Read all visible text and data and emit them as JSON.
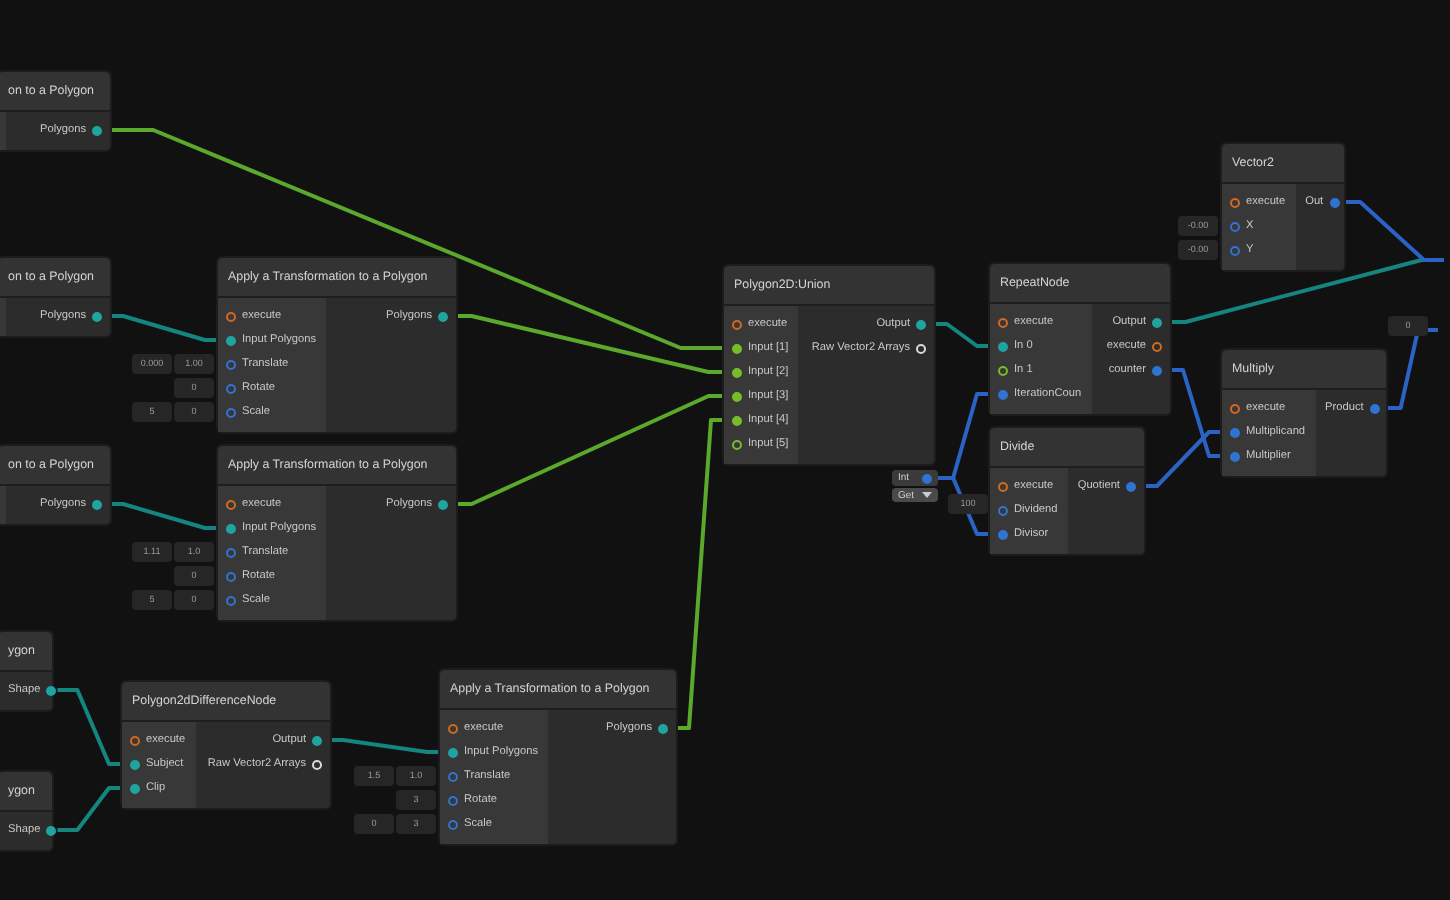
{
  "nodes": [
    {
      "title": "on to a Polygon",
      "outputs": [
        {
          "label": "Polygons",
          "kind": "polygon",
          "connected": true
        }
      ]
    },
    {
      "title": "on to a Polygon",
      "outputs": [
        {
          "label": "Polygons",
          "kind": "polygon",
          "connected": true
        }
      ]
    },
    {
      "title": "on to a Polygon",
      "outputs": [
        {
          "label": "Polygons",
          "kind": "polygon",
          "connected": true
        }
      ]
    },
    {
      "title": "ygon",
      "outputs": [
        {
          "label": "Shape",
          "kind": "polygon",
          "connected": true
        }
      ]
    },
    {
      "title": "ygon",
      "outputs": [
        {
          "label": "Shape",
          "kind": "polygon",
          "connected": true
        }
      ]
    },
    {
      "title": "Apply a Transformation to a Polygon",
      "inputs": [
        {
          "label": "execute",
          "kind": "exec",
          "connected": false
        },
        {
          "label": "Input Polygons",
          "kind": "polygon",
          "connected": true
        },
        {
          "label": "Translate",
          "kind": "number",
          "connected": false,
          "fields": [
            "0.000",
            "1.00"
          ]
        },
        {
          "label": "Rotate",
          "kind": "number",
          "connected": false,
          "fields": [
            "0"
          ]
        },
        {
          "label": "Scale",
          "kind": "number",
          "connected": false,
          "fields": [
            "5",
            "0"
          ]
        }
      ],
      "outputs": [
        {
          "label": "Polygons",
          "kind": "polygon",
          "connected": true
        }
      ]
    },
    {
      "title": "Apply a Transformation to a Polygon",
      "inputs": [
        {
          "label": "execute",
          "kind": "exec",
          "connected": false
        },
        {
          "label": "Input Polygons",
          "kind": "polygon",
          "connected": true
        },
        {
          "label": "Translate",
          "kind": "number",
          "connected": false,
          "fields": [
            "1.11",
            "1.0"
          ]
        },
        {
          "label": "Rotate",
          "kind": "number",
          "connected": false,
          "fields": [
            "0"
          ]
        },
        {
          "label": "Scale",
          "kind": "number",
          "connected": false,
          "fields": [
            "5",
            "0"
          ]
        }
      ],
      "outputs": [
        {
          "label": "Polygons",
          "kind": "polygon",
          "connected": true
        }
      ]
    },
    {
      "title": "Polygon2dDifferenceNode",
      "inputs": [
        {
          "label": "execute",
          "kind": "exec",
          "connected": false
        },
        {
          "label": "Subject",
          "kind": "polygon",
          "connected": true
        },
        {
          "label": "Clip",
          "kind": "polygon",
          "connected": true
        }
      ],
      "outputs": [
        {
          "label": "Output",
          "kind": "polygon",
          "connected": true
        },
        {
          "label": "Raw Vector2 Arrays",
          "kind": "array",
          "connected": false
        }
      ]
    },
    {
      "title": "Apply a Transformation to a Polygon",
      "inputs": [
        {
          "label": "execute",
          "kind": "exec",
          "connected": false
        },
        {
          "label": "Input Polygons",
          "kind": "polygon",
          "connected": true
        },
        {
          "label": "Translate",
          "kind": "number",
          "connected": false,
          "fields": [
            "1.5",
            "1.0"
          ]
        },
        {
          "label": "Rotate",
          "kind": "number",
          "connected": false,
          "fields": [
            "3"
          ]
        },
        {
          "label": "Scale",
          "kind": "number",
          "connected": false,
          "fields": [
            "0",
            "3"
          ]
        }
      ],
      "outputs": [
        {
          "label": "Polygons",
          "kind": "polygon",
          "connected": true
        }
      ]
    },
    {
      "title": "Polygon2D:Union",
      "inputs": [
        {
          "label": "execute",
          "kind": "exec",
          "connected": false
        },
        {
          "label": "Input [1]",
          "kind": "list",
          "connected": true
        },
        {
          "label": "Input [2]",
          "kind": "list",
          "connected": true
        },
        {
          "label": "Input [3]",
          "kind": "list",
          "connected": true
        },
        {
          "label": "Input [4]",
          "kind": "list",
          "connected": true
        },
        {
          "label": "Input [5]",
          "kind": "list",
          "connected": false
        }
      ],
      "outputs": [
        {
          "label": "Output",
          "kind": "polygon",
          "connected": true
        },
        {
          "label": "Raw Vector2 Arrays",
          "kind": "array",
          "connected": false
        }
      ]
    },
    {
      "title": "RepeatNode",
      "inputs": [
        {
          "label": "execute",
          "kind": "exec",
          "connected": false
        },
        {
          "label": "In 0",
          "kind": "polygon",
          "connected": true
        },
        {
          "label": "In 1",
          "kind": "list",
          "connected": false
        },
        {
          "label": "IterationCoun",
          "kind": "number",
          "connected": true
        }
      ],
      "outputs": [
        {
          "label": "Output",
          "kind": "polygon",
          "connected": true
        },
        {
          "label": "execute",
          "kind": "exec",
          "connected": false
        },
        {
          "label": "counter",
          "kind": "number",
          "connected": true
        }
      ]
    },
    {
      "title": "Divide",
      "inputs": [
        {
          "label": "execute",
          "kind": "exec",
          "connected": false
        },
        {
          "label": "Dividend",
          "kind": "number",
          "connected": false
        },
        {
          "label": "Divisor",
          "kind": "number",
          "connected": true
        }
      ],
      "outputs": [
        {
          "label": "Quotient",
          "kind": "number",
          "connected": true
        }
      ]
    },
    {
      "title": "Vector2",
      "inputs": [
        {
          "label": "execute",
          "kind": "exec",
          "connected": false
        },
        {
          "label": "X",
          "kind": "number",
          "connected": false,
          "fields": [
            "-0.00"
          ]
        },
        {
          "label": "Y",
          "kind": "number",
          "connected": false,
          "fields": [
            "-0.00"
          ]
        }
      ],
      "outputs": [
        {
          "label": "Out",
          "kind": "number",
          "connected": true
        }
      ]
    },
    {
      "title": "Multiply",
      "inputs": [
        {
          "label": "execute",
          "kind": "exec",
          "connected": false
        },
        {
          "label": "Multiplicand",
          "kind": "number",
          "connected": true
        },
        {
          "label": "Multiplier",
          "kind": "number",
          "connected": true
        }
      ],
      "outputs": [
        {
          "label": "Product",
          "kind": "number",
          "connected": true
        }
      ]
    }
  ],
  "variable_node": {
    "name": "Int",
    "mode": "Get"
  },
  "floating_fields": [
    "100",
    "0"
  ]
}
